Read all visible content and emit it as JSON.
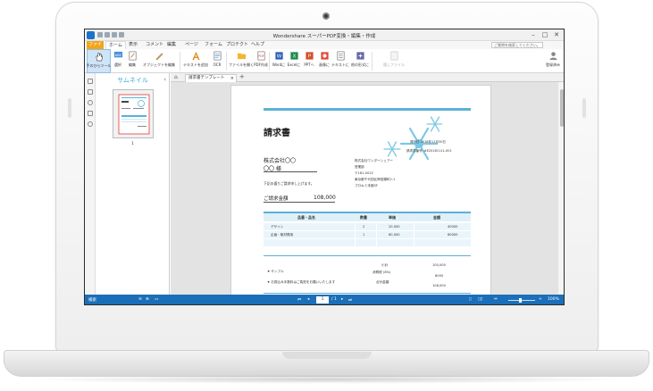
{
  "window": {
    "title": "Wondershare スーパーPDF変換・編集・作成",
    "minimize": "–",
    "maximize": "□",
    "close": "✕"
  },
  "menu": {
    "file": "ファイル",
    "tabs": [
      "ホーム",
      "表示",
      "コメント",
      "編集",
      "ページ",
      "フォーム",
      "プロテクト",
      "ヘルプ"
    ],
    "help_search_placeholder": "ご質問を検索してください。"
  },
  "ribbon": {
    "buttons": [
      {
        "label": "手のひらツール",
        "icon": "hand-icon"
      },
      {
        "label": "選択",
        "icon": "select-icon"
      },
      {
        "label": "編集",
        "icon": "edit-icon"
      },
      {
        "label": "オブジェクトを編集",
        "icon": "object-edit-icon"
      },
      {
        "label": "テキストを追加",
        "icon": "add-text-icon"
      },
      {
        "label": "OCR",
        "icon": "ocr-icon"
      },
      {
        "label": "ファイルを開く",
        "icon": "open-file-icon"
      },
      {
        "label": "PDF作成",
        "icon": "pdf-create-icon"
      },
      {
        "label": "Wordに",
        "icon": "word-icon"
      },
      {
        "label": "Excelに",
        "icon": "excel-icon"
      },
      {
        "label": "PPTへ",
        "icon": "ppt-icon"
      },
      {
        "label": "画像に",
        "icon": "image-icon"
      },
      {
        "label": "テキストに",
        "icon": "text-icon"
      },
      {
        "label": "他の形式に",
        "icon": "other-format-icon"
      },
      {
        "label": "隠しファイル",
        "icon": "hidden-file-icon"
      }
    ],
    "account": "登録済み"
  },
  "thumbnails": {
    "title": "サムネイル",
    "close": "‹",
    "page_number": "1"
  },
  "tabs": {
    "home": "⌂",
    "document": "請求書テンプレート",
    "close": "×",
    "new": "+"
  },
  "invoice": {
    "title": "請求書",
    "date": "発行日 2018年11月30日",
    "number": "請求書番号: #E20181111-001",
    "customer": "株式会社〇〇",
    "customer_suffix": "〇〇 様",
    "seller": [
      "株式会社ワンダーシェアー",
      "営業部",
      "〒181-0022",
      "東京都千代田区神田錦町2-1",
      "プロキミ本館3F"
    ],
    "intro": "下記の通りご請求申し上げます。",
    "total_label": "ご請求金額",
    "total_value": "108,000",
    "table": {
      "headers": [
        "品番・品名",
        "数量",
        "単価",
        "金額"
      ],
      "rows": [
        [
          "デザイン",
          "2",
          "20,000",
          "40000"
        ],
        [
          "企画・取材費用",
          "1",
          "60,000",
          "60000"
        ],
        [
          "",
          "",
          "",
          ""
        ],
        [
          "",
          "",
          "",
          ""
        ]
      ]
    },
    "subtotal_label": "小計",
    "subtotal_value": "100,000",
    "tax_label": "消費税 (8%)",
    "tax_value": "8000",
    "grand_label": "合計金額",
    "grand_value": "108,000",
    "note1": "★ サンプル",
    "note2": "★ お振込み手数料はご負担をお願いいたします"
  },
  "status": {
    "left": "検索",
    "page": "1",
    "page_total": "/ 1",
    "zoom": "100%"
  },
  "colors": {
    "accent": "#1b6fb8",
    "file_tab": "#f2a51a",
    "invoice_blue": "#5bb1d6"
  }
}
